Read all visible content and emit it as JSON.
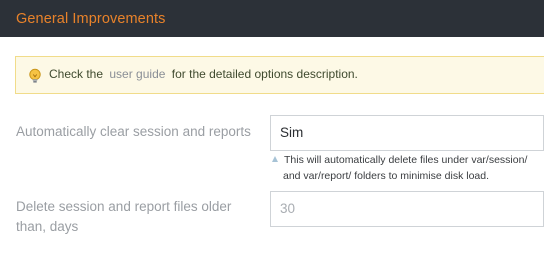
{
  "header": {
    "title": "General Improvements"
  },
  "notice": {
    "icon": "lightbulb-icon",
    "text_before": "Check the",
    "link_text": "user guide",
    "text_after": "for the detailed options description."
  },
  "settings": {
    "clear_session": {
      "label": "Automatically clear session and reports",
      "value": "Sim",
      "hint_line1": "This will automatically delete files under var/session/",
      "hint_line2": "and var/report/ folders to minimise disk load."
    },
    "delete_older": {
      "label_line1": "Delete session and report files older",
      "label_line2": "than, days",
      "value": "30"
    }
  },
  "colors": {
    "header_bg": "#2c3138",
    "header_title": "#e8822a",
    "notice_bg": "#fdf9e6"
  }
}
